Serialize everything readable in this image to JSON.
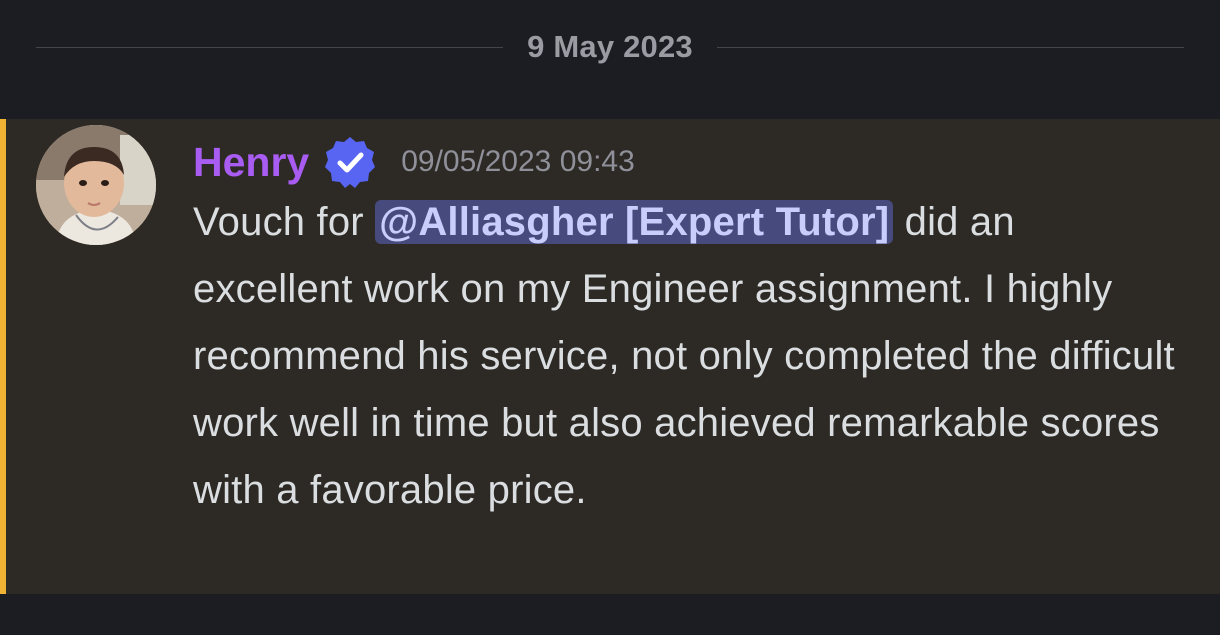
{
  "divider": {
    "date": "9 May 2023"
  },
  "message": {
    "author": "Henry",
    "timestamp": "09/05/2023 09:43",
    "text_before": "Vouch for ",
    "mention": "@Alliasgher [Expert Tutor]",
    "text_after": " did an excellent work on my Engineer assignment. I highly recommend his service, not only completed the difficult work well in time but also achieved remarkable scores with a favorable price."
  },
  "icons": {
    "verified": "verified-badge-icon",
    "avatar": "avatar"
  },
  "colors": {
    "background": "#1c1d22",
    "highlight_background": "#2d2a25",
    "accent_bar": "#f0b232",
    "author": "#a95cf2",
    "verified_badge": "#5865f2",
    "mention_background": "#474a7d",
    "mention_text": "#c9cdfb",
    "body_text": "#dbdee1",
    "timestamp": "#8f9099"
  }
}
